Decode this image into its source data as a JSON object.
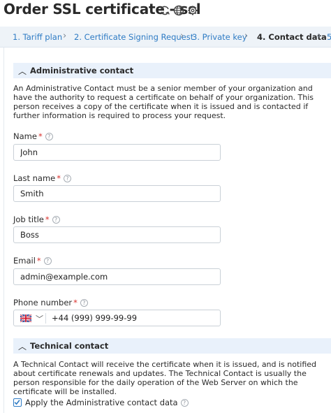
{
  "header": {
    "title": "Order SSL certificate - ssl",
    "icons": [
      "refresh-icon",
      "globe-icon",
      "gear-icon"
    ]
  },
  "steps": [
    {
      "label": "1. Tariff plan",
      "active": false
    },
    {
      "label": "2. Certificate Signing Request",
      "active": false
    },
    {
      "label": "3. Private key",
      "active": false
    },
    {
      "label": "4. Contact data",
      "active": true
    },
    {
      "label": "5",
      "active": false
    }
  ],
  "admin": {
    "heading": "Administrative contact",
    "description": "An Administrative Contact must be a senior member of your organization and have the authority to request a certificate on behalf of your organization. This person receives a copy of the certificate when it is issued and is contacted if further information is required to process your request.",
    "fields": {
      "name": {
        "label": "Name",
        "required_mark": "*",
        "value": "John"
      },
      "last_name": {
        "label": "Last name",
        "required_mark": "*",
        "value": "Smith"
      },
      "job_title": {
        "label": "Job title",
        "required_mark": "*",
        "value": "Boss"
      },
      "email": {
        "label": "Email",
        "required_mark": "*",
        "value": "admin@example.com"
      },
      "phone": {
        "label": "Phone number",
        "required_mark": "*",
        "value": "+44 (999) 999-99-99",
        "country": "GB"
      }
    }
  },
  "tech": {
    "heading": "Technical contact",
    "description": "A Technical Contact will receive the certificate when it is issued, and is notified about certificate renewals and updates. The Technical Contact is usually the person responsible for the daily operation of the Web Server on which the certificate will be installed.",
    "apply_label": "Apply the Administrative contact data",
    "apply_checked": true
  },
  "help_glyph": "?",
  "colors": {
    "link": "#2e7bc4",
    "required": "#d9302c",
    "section_bg": "#e9f1fb",
    "steps_bg": "#eef3f8"
  }
}
